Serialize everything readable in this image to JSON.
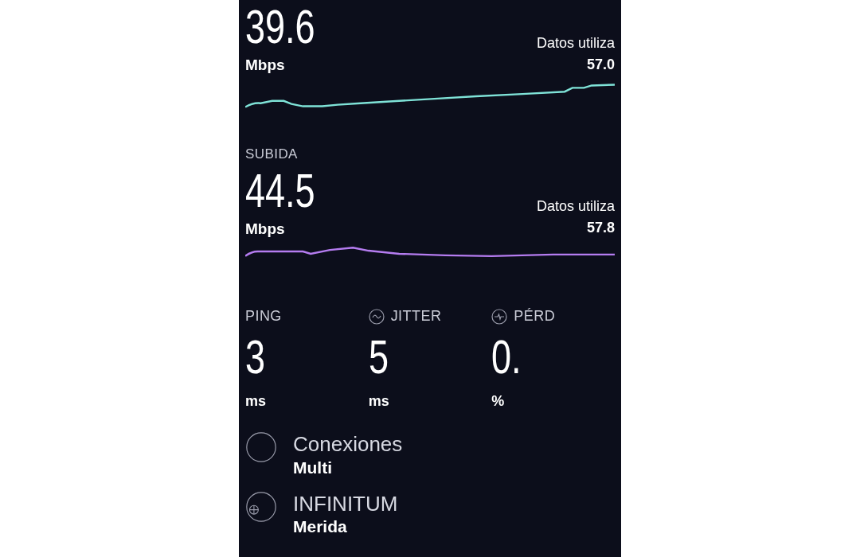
{
  "download": {
    "value": "39.6",
    "unit": "Mbps",
    "data_label": "Datos utiliza",
    "data_value": "57.0"
  },
  "upload": {
    "label": "SUBIDA",
    "value": "44.5",
    "unit": "Mbps",
    "data_label": "Datos utiliza",
    "data_value": "57.8"
  },
  "metrics": [
    {
      "kind": "ping",
      "label": "PING",
      "value": "3",
      "unit": "ms"
    },
    {
      "kind": "jitter",
      "label": "JITTER",
      "value": "5",
      "unit": "ms"
    },
    {
      "kind": "loss",
      "label": "PÉRD",
      "value": "0.",
      "unit": "%"
    }
  ],
  "details": [
    {
      "kind": "connections",
      "title": "Conexiones",
      "value": "Multi"
    },
    {
      "kind": "server",
      "title": "INFINITUM",
      "value": "Merida"
    }
  ]
}
